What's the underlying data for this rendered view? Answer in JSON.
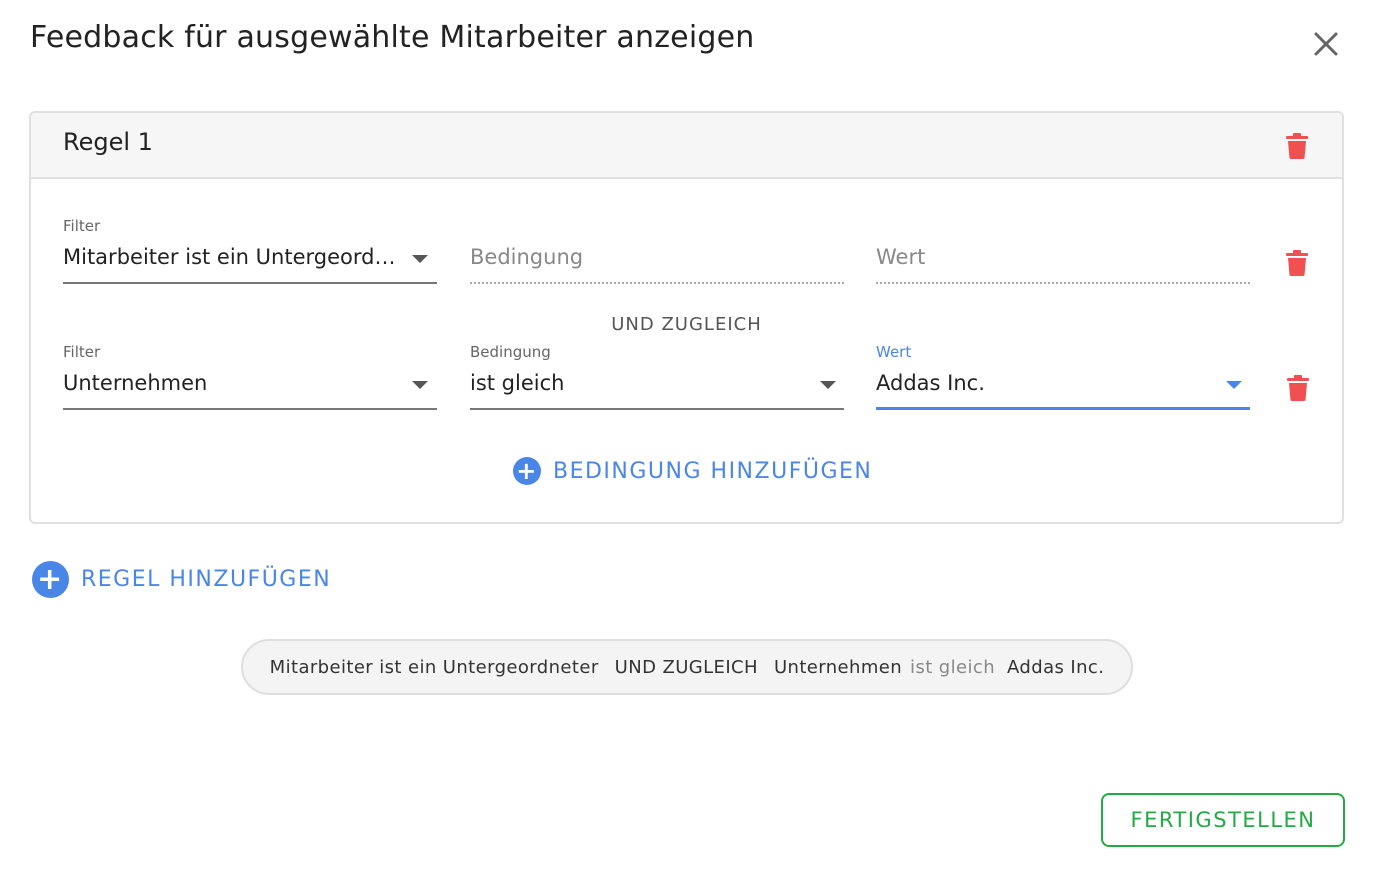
{
  "dialog": {
    "title": "Feedback für ausgewählte Mitarbeiter anzeigen"
  },
  "rule": {
    "title": "Regel 1",
    "rows": [
      {
        "filter_label": "Filter",
        "filter_value": "Mitarbeiter ist ein Untergeordneter",
        "condition_placeholder": "Bedingung",
        "value_placeholder": "Wert"
      },
      {
        "filter_label": "Filter",
        "filter_value": "Unternehmen",
        "condition_label": "Bedingung",
        "condition_value": "ist gleich",
        "value_label": "Wert",
        "value_value": "Addas Inc."
      }
    ],
    "connector": "UND ZUGLEICH",
    "add_condition_label": "BEDINGUNG HINZUFÜGEN"
  },
  "add_rule_label": "REGEL HINZUFÜGEN",
  "summary": {
    "part1": "Mitarbeiter ist ein Untergeordneter",
    "connector": "UND ZUGLEICH",
    "part2_field": "Unternehmen",
    "part2_operator": "ist gleich",
    "part2_value": "Addas Inc."
  },
  "finish_label": "FERTIGSTELLEN",
  "colors": {
    "accent": "#4a86e8",
    "delete": "#f05050",
    "success": "#22aa44"
  }
}
